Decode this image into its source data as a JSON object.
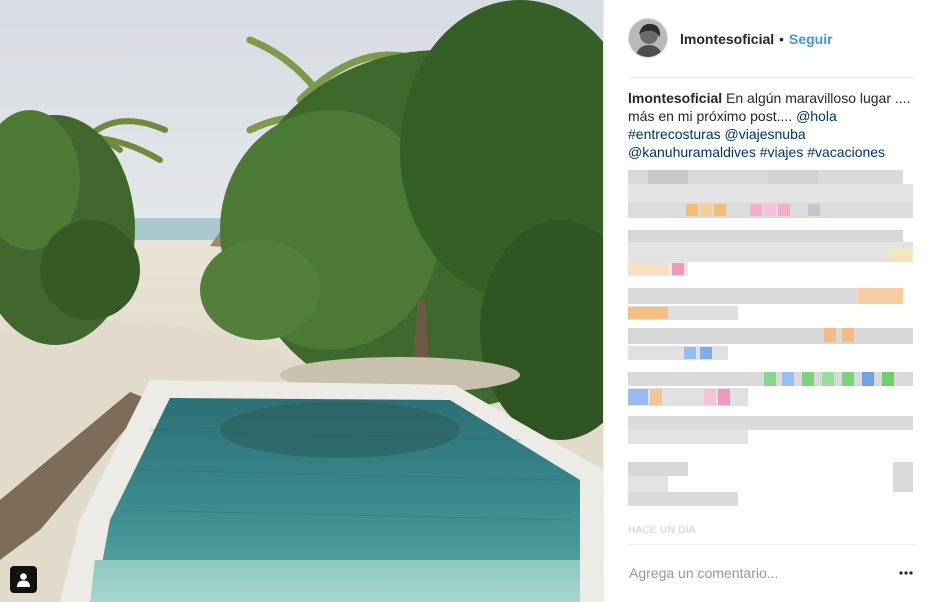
{
  "post": {
    "username": "lmontesoficial",
    "dot": "•",
    "follow_label": "Seguir",
    "caption_prefix": " En algún maravilloso lugar .... más en mi próximo post.... ",
    "tags": [
      "@hola",
      "#entrecosturas",
      "@viajesnuba",
      "@kanuhuramaldives",
      "#viajes",
      "#vacaciones"
    ],
    "timestamp": "HACE UN DÍA",
    "comment_placeholder": "Agrega un comentario...",
    "more_label": "•••"
  },
  "icons": {
    "tag": "user-tag-icon",
    "more": "more-options-icon"
  },
  "colors": {
    "link": "#003569",
    "follow": "#3897f0",
    "text": "#262626",
    "muted": "#999999"
  }
}
